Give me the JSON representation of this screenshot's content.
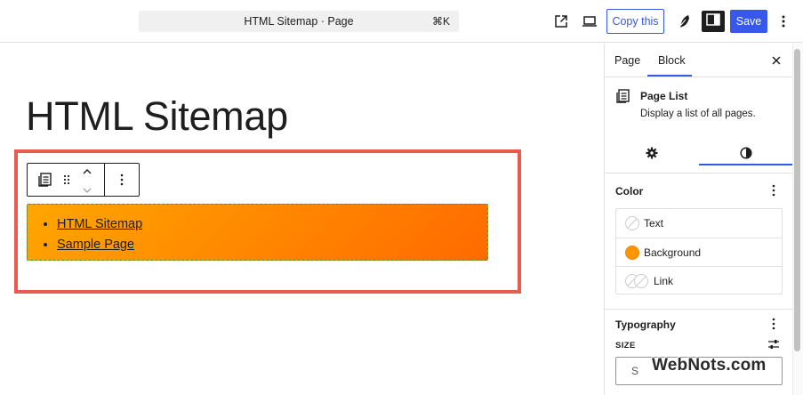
{
  "topbar": {
    "command_title": "HTML Sitemap · Page",
    "command_shortcut": "⌘K",
    "copy_label": "Copy this",
    "save_label": "Save"
  },
  "editor": {
    "page_title": "HTML Sitemap",
    "page_list": [
      "HTML Sitemap",
      "Sample Page"
    ]
  },
  "sidebar": {
    "tabs": [
      {
        "label": "Page",
        "active": false
      },
      {
        "label": "Block",
        "active": true
      }
    ],
    "block": {
      "name": "Page List",
      "description": "Display a list of all pages."
    },
    "color_panel": {
      "title": "Color",
      "items": [
        {
          "label": "Text"
        },
        {
          "label": "Background",
          "swatch": "#ff9500"
        },
        {
          "label": "Link"
        }
      ]
    },
    "typography_panel": {
      "title": "Typography",
      "size_label": "SIZE",
      "size_value": "S"
    }
  },
  "watermark": "WebNots.com",
  "colors": {
    "accent": "#3858e9",
    "highlight_border": "#e95a4f",
    "gradient_start": "#ffa600",
    "gradient_end": "#ff6a00"
  }
}
